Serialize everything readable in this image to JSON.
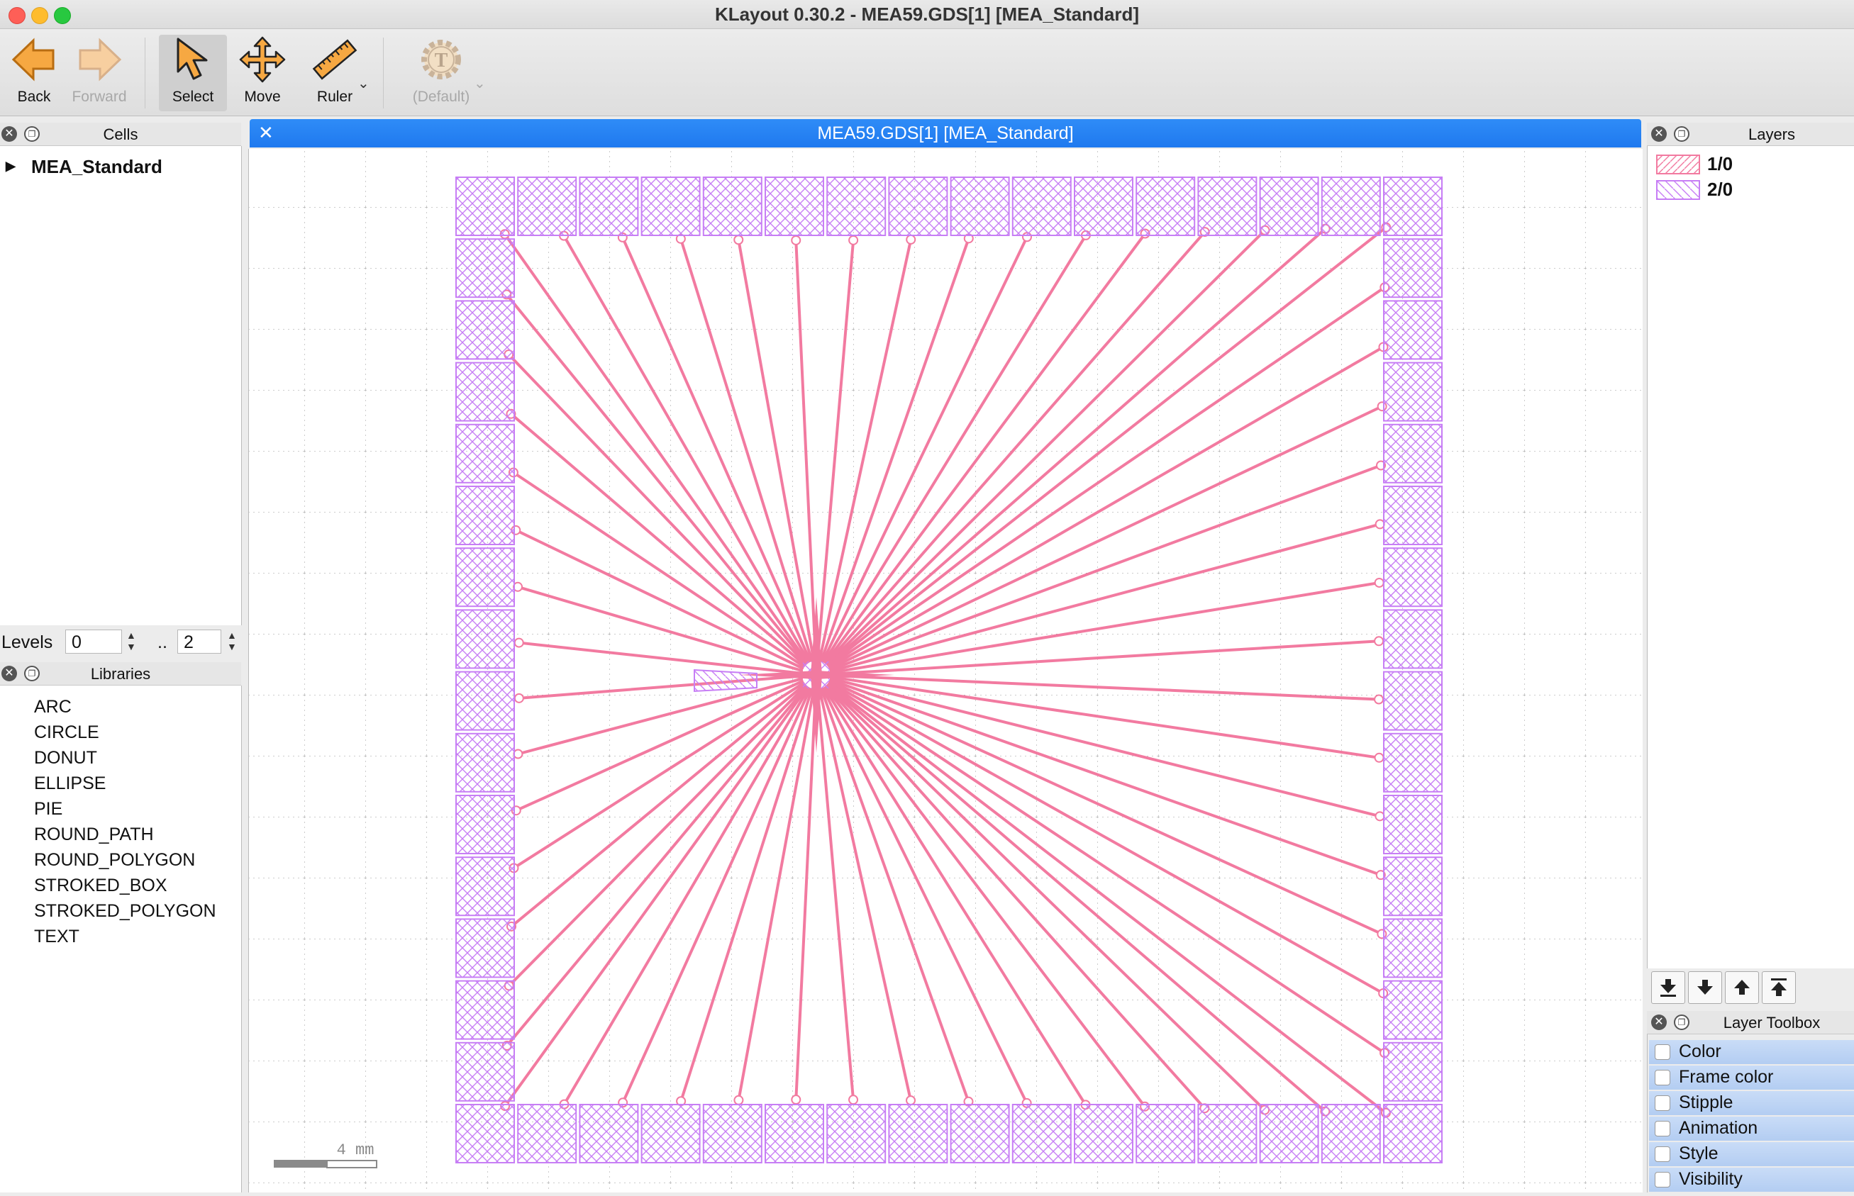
{
  "window": {
    "title": "KLayout 0.30.2 - MEA59.GDS[1] [MEA_Standard]"
  },
  "toolbar": {
    "back": "Back",
    "forward": "Forward",
    "select": "Select",
    "move": "Move",
    "ruler": "Ruler",
    "default": "(Default)"
  },
  "cells": {
    "title": "Cells",
    "items": [
      "MEA_Standard"
    ]
  },
  "levels": {
    "label": "Levels",
    "from": "0",
    "sep": "..",
    "to": "2"
  },
  "libraries": {
    "title": "Libraries",
    "items": [
      "ARC",
      "CIRCLE",
      "DONUT",
      "ELLIPSE",
      "PIE",
      "ROUND_PATH",
      "ROUND_POLYGON",
      "STROKED_BOX",
      "STROKED_POLYGON",
      "TEXT"
    ]
  },
  "view": {
    "tab_title": "MEA59.GDS[1] [MEA_Standard]",
    "scale_label": "4 mm"
  },
  "layers": {
    "title": "Layers",
    "items": [
      {
        "name": "1/0",
        "color": "#f27aa0"
      },
      {
        "name": "2/0",
        "color": "#c77ef5"
      }
    ]
  },
  "layer_toolbox": {
    "title": "Layer Toolbox",
    "items": [
      "Color",
      "Frame color",
      "Stipple",
      "Animation",
      "Style",
      "Visibility"
    ]
  }
}
